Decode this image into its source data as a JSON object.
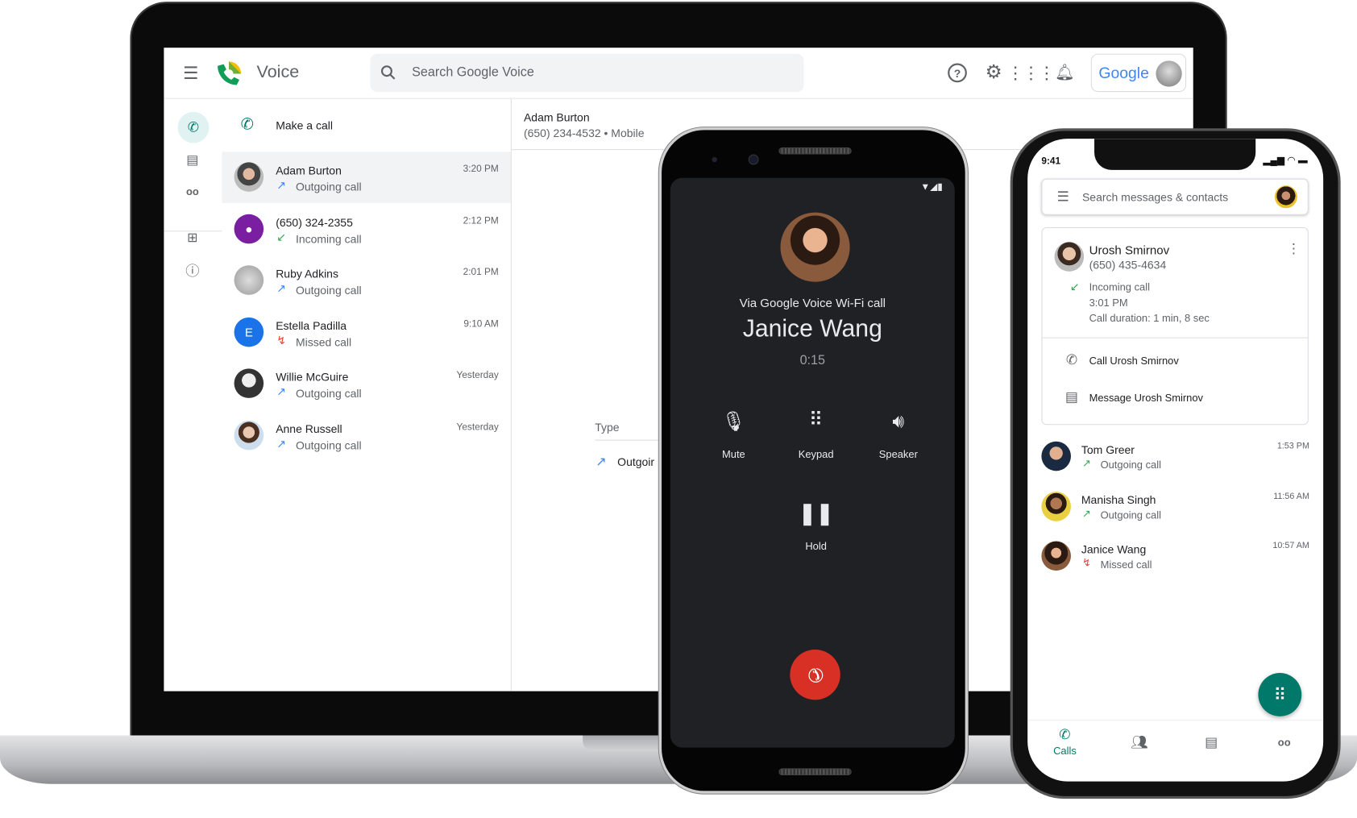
{
  "laptop": {
    "app_name": "Voice",
    "search_placeholder": "Search Google Voice",
    "header_icons": [
      "help-icon",
      "settings-icon",
      "apps-icon",
      "notifications-icon"
    ],
    "account_label": "Google",
    "rail": [
      "calls-icon",
      "messages-icon",
      "voicemail-icon",
      "archive-icon",
      "spam-icon"
    ],
    "make_call": "Make a call",
    "calls": [
      {
        "name": "Adam Burton",
        "type": "Outgoing call",
        "time": "3:20 PM",
        "kind": "outgoing"
      },
      {
        "name": "(650) 324-2355",
        "type": "Incoming call",
        "time": "2:12 PM",
        "kind": "incoming"
      },
      {
        "name": "Ruby Adkins",
        "type": "Outgoing call",
        "time": "2:01 PM",
        "kind": "outgoing"
      },
      {
        "name": "Estella Padilla",
        "type": "Missed call",
        "time": "9:10 AM",
        "kind": "missed",
        "initial": "E"
      },
      {
        "name": "Willie McGuire",
        "type": "Outgoing call",
        "time": "Yesterday",
        "kind": "outgoing"
      },
      {
        "name": "Anne Russell",
        "type": "Outgoing call",
        "time": "Yesterday",
        "kind": "outgoing"
      }
    ],
    "detail": {
      "name": "Adam Burton",
      "number": "(650) 234-4532 • Mobile",
      "type_header": "Type",
      "type_value": "Outgoir"
    }
  },
  "android": {
    "via": "Via Google Voice Wi-Fi call",
    "caller": "Janice Wang",
    "timer": "0:15",
    "actions": [
      "Mute",
      "Keypad",
      "Speaker"
    ],
    "hold": "Hold"
  },
  "iphone": {
    "clock": "9:41",
    "search_placeholder": "Search messages & contacts",
    "detail": {
      "name": "Urosh Smirnov",
      "number": "(650) 435-4634",
      "type": "Incoming call",
      "time": "3:01 PM",
      "duration": "Call duration: 1 min, 8 sec",
      "call_action": "Call Urosh Smirnov",
      "message_action": "Message Urosh Smirnov"
    },
    "calls": [
      {
        "name": "Tom Greer",
        "type": "Outgoing call",
        "time": "1:53 PM",
        "kind": "outgoing"
      },
      {
        "name": "Manisha Singh",
        "type": "Outgoing call",
        "time": "11:56 AM",
        "kind": "outgoing"
      },
      {
        "name": "Janice Wang",
        "type": "Missed call",
        "time": "10:57 AM",
        "kind": "missed"
      }
    ],
    "nav": {
      "calls": "Calls"
    }
  },
  "colors": {
    "accent": "#00796b",
    "outgoing": "#4285f4",
    "incoming": "#34a853",
    "missed": "#ea4335",
    "end_call": "#d93025"
  }
}
